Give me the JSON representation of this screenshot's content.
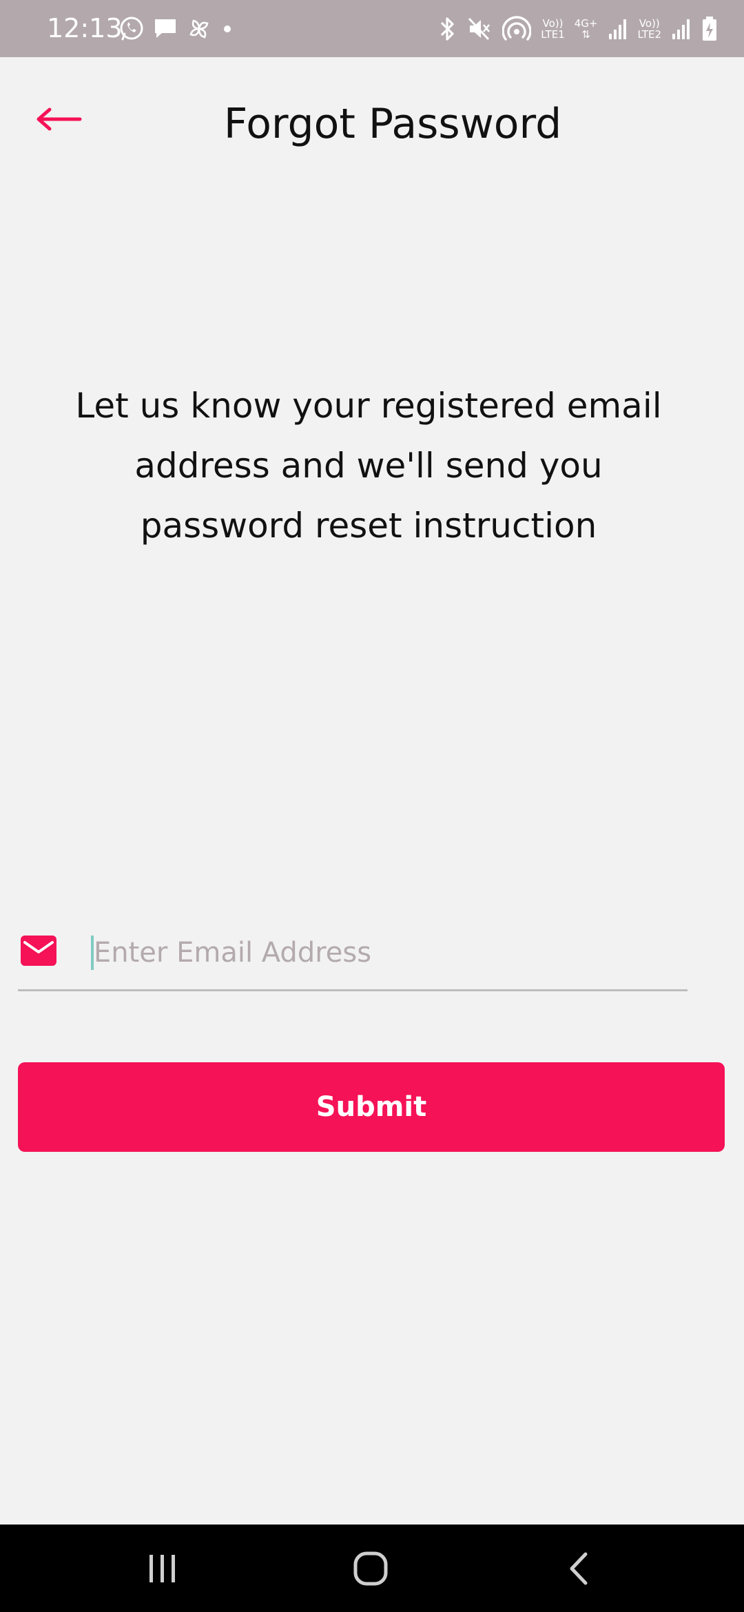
{
  "status_bar": {
    "time": "12:13",
    "sim1_label_top": "Vo))",
    "sim1_label_bottom": "LTE1",
    "network_type": "4G+",
    "sim2_label_top": "Vo))",
    "sim2_label_bottom": "LTE2",
    "icons": [
      "whatsapp-icon",
      "message-icon",
      "pinwheel-icon",
      "dot-icon",
      "bluetooth-icon",
      "mute-icon",
      "hotspot-icon",
      "signal-icon",
      "battery-icon"
    ]
  },
  "header": {
    "title": "Forgot Password",
    "back_icon": "arrow-left-icon"
  },
  "instruction": {
    "text": "Let us know your registered email address and we'll send you password reset instruction"
  },
  "email": {
    "icon": "mail-icon",
    "placeholder": "Enter Email Address",
    "value": ""
  },
  "submit": {
    "label": "Submit"
  },
  "nav": {
    "icons": [
      "recent-apps-icon",
      "home-icon",
      "back-icon"
    ]
  },
  "colors": {
    "accent": "#f51257",
    "status_bar": "#b3a9ac",
    "background": "#f2f2f2",
    "placeholder": "#b3aaad",
    "caret": "#7fcbc3"
  }
}
